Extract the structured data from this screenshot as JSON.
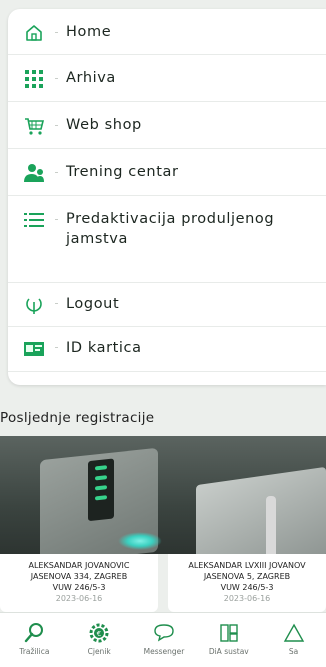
{
  "menu": {
    "items": [
      {
        "label": "Home",
        "icon": "home-icon"
      },
      {
        "label": "Arhiva",
        "icon": "grid-dots-icon"
      },
      {
        "label": "Web shop",
        "icon": "cart-icon"
      },
      {
        "label": "Trening centar",
        "icon": "people-icon"
      },
      {
        "label": "Predaktivacija produljenog jamstva",
        "icon": "list-icon"
      },
      {
        "label": "Logout",
        "icon": "logout-icon"
      },
      {
        "label": "ID kartica",
        "icon": "id-card-icon"
      }
    ]
  },
  "main": {
    "section_title": "Posljednje registracije",
    "cards": [
      {
        "name": "ALEKSANDAR JOVANOVIC",
        "address": "JASENOVA 334, ZAGREB",
        "code": "VUW 246/5-3",
        "date": "2023-06-16"
      },
      {
        "name": "ALEKSANDAR LVXIII JOVANOV",
        "address": "JASENOVA 5, ZAGREB",
        "code": "VUW 246/5-3",
        "date": "2023-06-16"
      }
    ]
  },
  "bottom_nav": [
    {
      "label": "Tražilica",
      "icon": "search-icon"
    },
    {
      "label": "Cjenik",
      "icon": "euro-gear-icon"
    },
    {
      "label": "Messenger",
      "icon": "chat-icon"
    },
    {
      "label": "DiA sustav",
      "icon": "dia-icon"
    },
    {
      "label": "Sa",
      "icon": "warning-icon"
    }
  ],
  "colors": {
    "accent": "#1aa35a",
    "icon_stroke": "#1f8e4d",
    "background": "#ecefec"
  }
}
